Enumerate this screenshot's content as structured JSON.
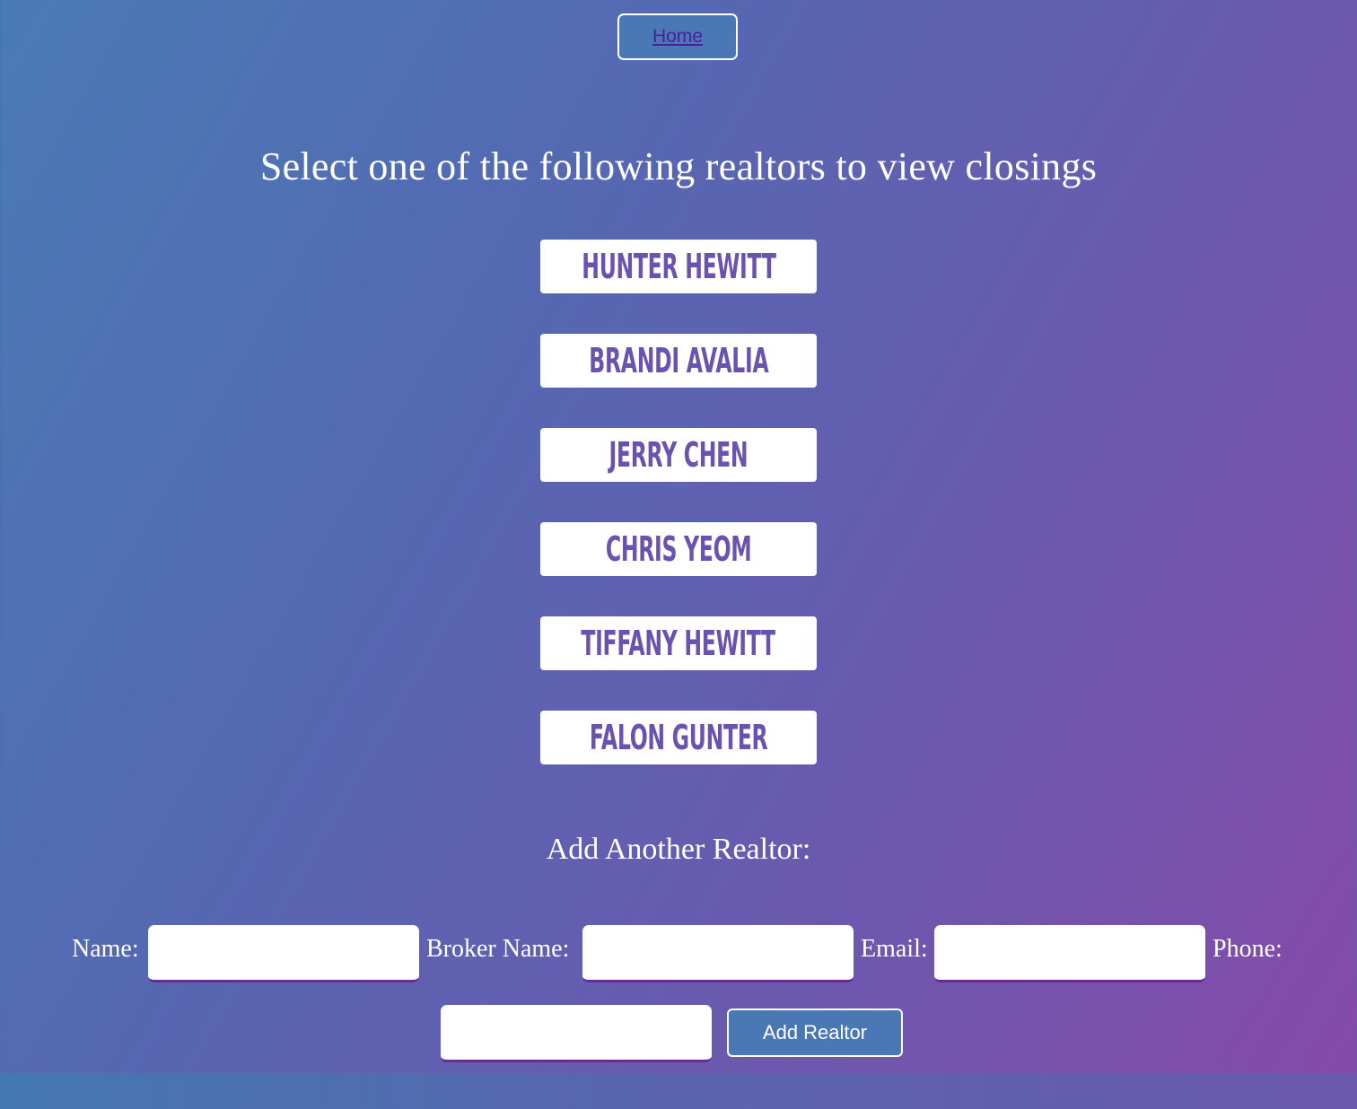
{
  "nav": {
    "home_label": "Home"
  },
  "page": {
    "title": "Select one of the following realtors to view closings"
  },
  "realtors": [
    {
      "name": "Hunter Hewitt"
    },
    {
      "name": "Brandi Avalia"
    },
    {
      "name": "Jerry Chen"
    },
    {
      "name": "Chris Yeom"
    },
    {
      "name": "Tiffany Hewitt"
    },
    {
      "name": "Falon Gunter"
    }
  ],
  "add_form": {
    "title": "Add Another Realtor:",
    "name_label": "Name:",
    "name_value": "",
    "broker_label": "Broker Name:",
    "broker_value": "",
    "email_label": "Email:",
    "email_value": "",
    "phone_label": "Phone:",
    "phone_value": "",
    "submit_label": "Add Realtor"
  },
  "colors": {
    "accent_button": "#4a78b4",
    "realtor_text": "#6a52b0",
    "link": "#4a1f9a",
    "input_underline": "#6a2a96"
  }
}
